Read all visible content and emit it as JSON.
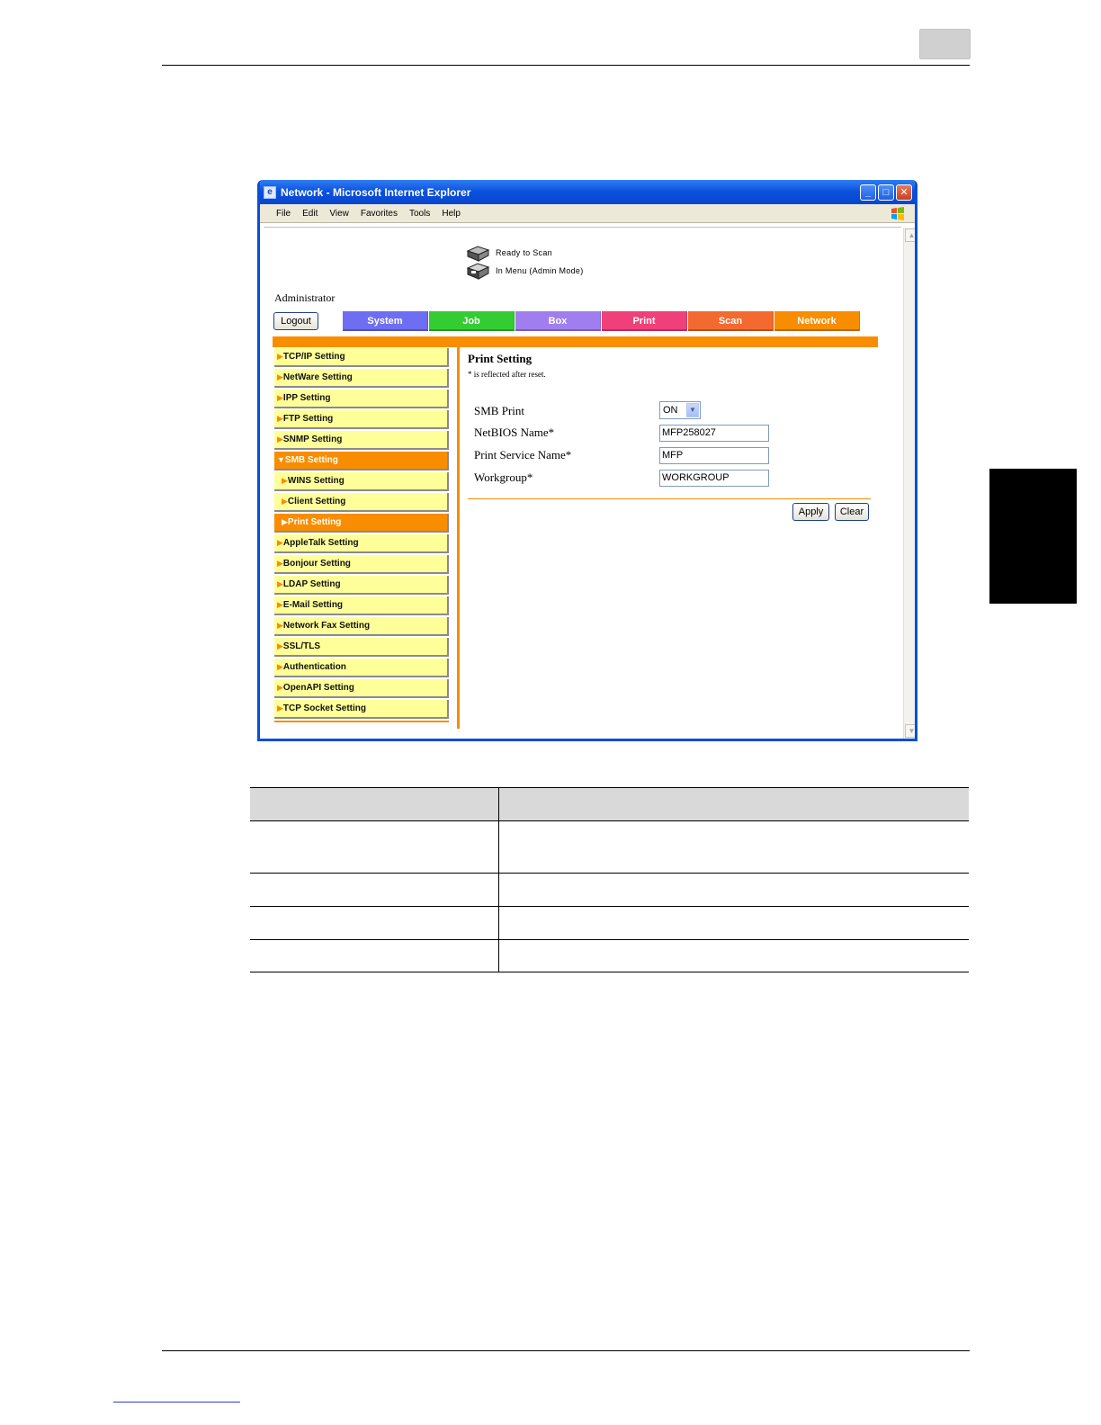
{
  "window": {
    "title": "Network - Microsoft Internet Explorer",
    "controls": [
      "_",
      "□",
      "✕"
    ]
  },
  "menubar": [
    "File",
    "Edit",
    "View",
    "Favorites",
    "Tools",
    "Help"
  ],
  "status": {
    "line1": "Ready to Scan",
    "line2": "In Menu (Admin Mode)"
  },
  "user": {
    "label": "Administrator",
    "logout": "Logout"
  },
  "tabs": [
    {
      "label": "System",
      "color": "#6e6ef2"
    },
    {
      "label": "Job",
      "color": "#33cc33"
    },
    {
      "label": "Box",
      "color": "#a07ef0"
    },
    {
      "label": "Print",
      "color": "#f0407a"
    },
    {
      "label": "Scan",
      "color": "#f26a30"
    },
    {
      "label": "Network",
      "color": "#f88d00"
    }
  ],
  "nav": [
    {
      "label": "TCP/IP Setting",
      "marker": "▶",
      "sub": false,
      "active": false
    },
    {
      "label": "NetWare Setting",
      "marker": "▶",
      "sub": false,
      "active": false
    },
    {
      "label": "IPP Setting",
      "marker": "▶",
      "sub": false,
      "active": false
    },
    {
      "label": "FTP Setting",
      "marker": "▶",
      "sub": false,
      "active": false
    },
    {
      "label": "SNMP Setting",
      "marker": "▶",
      "sub": false,
      "active": false
    },
    {
      "label": "SMB Setting",
      "marker": "▼",
      "sub": false,
      "active": true
    },
    {
      "label": "WINS Setting",
      "marker": "▶",
      "sub": true,
      "active": false
    },
    {
      "label": "Client Setting",
      "marker": "▶",
      "sub": true,
      "active": false
    },
    {
      "label": "Print Setting",
      "marker": "▶",
      "sub": true,
      "active": true
    },
    {
      "label": "AppleTalk Setting",
      "marker": "▶",
      "sub": false,
      "active": false
    },
    {
      "label": "Bonjour Setting",
      "marker": "▶",
      "sub": false,
      "active": false
    },
    {
      "label": "LDAP Setting",
      "marker": "▶",
      "sub": false,
      "active": false
    },
    {
      "label": "E-Mail Setting",
      "marker": "▶",
      "sub": false,
      "active": false
    },
    {
      "label": "Network Fax Setting",
      "marker": "▶",
      "sub": false,
      "active": false
    },
    {
      "label": "SSL/TLS",
      "marker": "▶",
      "sub": false,
      "active": false
    },
    {
      "label": "Authentication",
      "marker": "▶",
      "sub": false,
      "active": false
    },
    {
      "label": "OpenAPI Setting",
      "marker": "▶",
      "sub": false,
      "active": false
    },
    {
      "label": "TCP Socket Setting",
      "marker": "▶",
      "sub": false,
      "active": false
    }
  ],
  "content": {
    "title": "Print Setting",
    "note": "* is reflected after reset.",
    "smb_print": {
      "label": "SMB Print",
      "value": "ON"
    },
    "netbios": {
      "label": "NetBIOS Name*",
      "value": "MFP258027"
    },
    "service": {
      "label": "Print Service Name*",
      "value": "MFP"
    },
    "workgroup": {
      "label": "Workgroup*",
      "value": "WORKGROUP"
    },
    "apply": "Apply",
    "clear": "Clear"
  },
  "colors": {
    "accent": "#f88d00",
    "nav_bg": "#ffff99",
    "titlebar": "#0a4fdc"
  }
}
